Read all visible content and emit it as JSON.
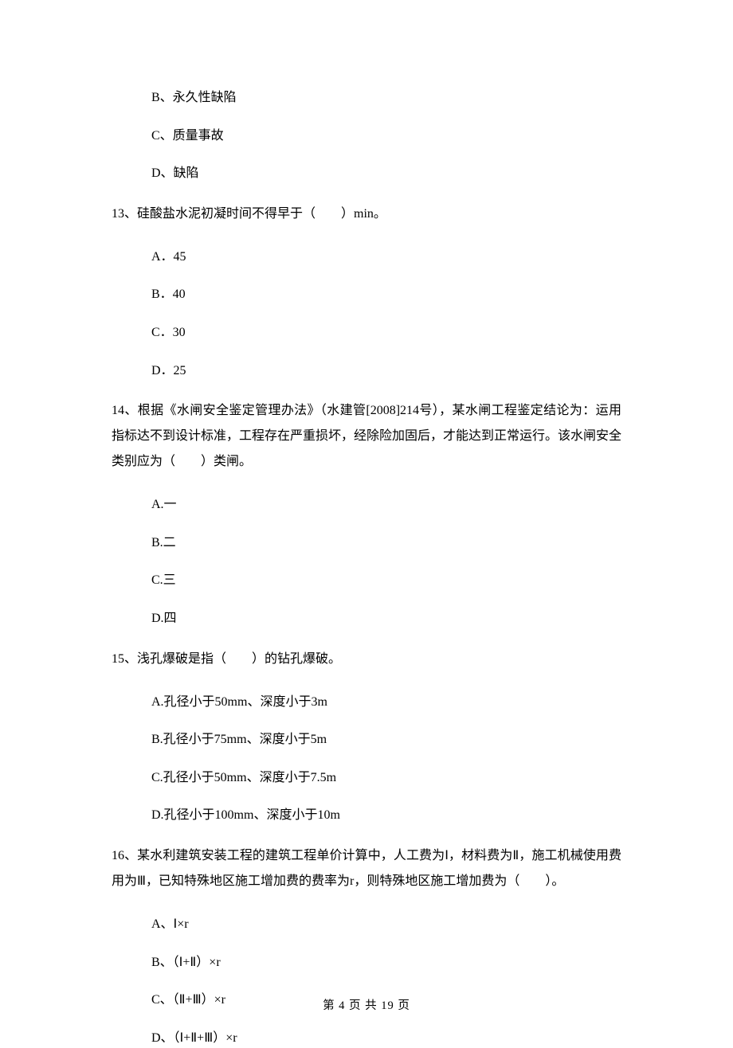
{
  "q12": {
    "optB": "B、永久性缺陷",
    "optC": "C、质量事故",
    "optD": "D、缺陷"
  },
  "q13": {
    "stem": "13、硅酸盐水泥初凝时间不得早于（　　）min。",
    "optA": "A．45",
    "optB": "B．40",
    "optC": "C．30",
    "optD": "D．25"
  },
  "q14": {
    "stem": "14、根据《水闸安全鉴定管理办法》（水建管[2008]214号），某水闸工程鉴定结论为：运用指标达不到设计标准，工程存在严重损坏，经除险加固后，才能达到正常运行。该水闸安全类别应为（　　）类闸。",
    "optA": "A.一",
    "optB": "B.二",
    "optC": "C.三",
    "optD": "D.四"
  },
  "q15": {
    "stem": "15、浅孔爆破是指（　　）的钻孔爆破。",
    "optA": "A.孔径小于50mm、深度小于3m",
    "optB": "B.孔径小于75mm、深度小于5m",
    "optC": "C.孔径小于50mm、深度小于7.5m",
    "optD": "D.孔径小于100mm、深度小于10m"
  },
  "q16": {
    "stem": "16、某水利建筑安装工程的建筑工程单价计算中，人工费为Ⅰ，材料费为Ⅱ，施工机械使用费用为Ⅲ，已知特殊地区施工增加费的费率为r，则特殊地区施工增加费为（　　）。",
    "optA": "A、Ⅰ×r",
    "optB": "B、（Ⅰ+Ⅱ）×r",
    "optC": "C、（Ⅱ+Ⅲ）×r",
    "optD": "D、（Ⅰ+Ⅱ+Ⅲ）×r"
  },
  "footer": "第 4 页 共 19 页"
}
